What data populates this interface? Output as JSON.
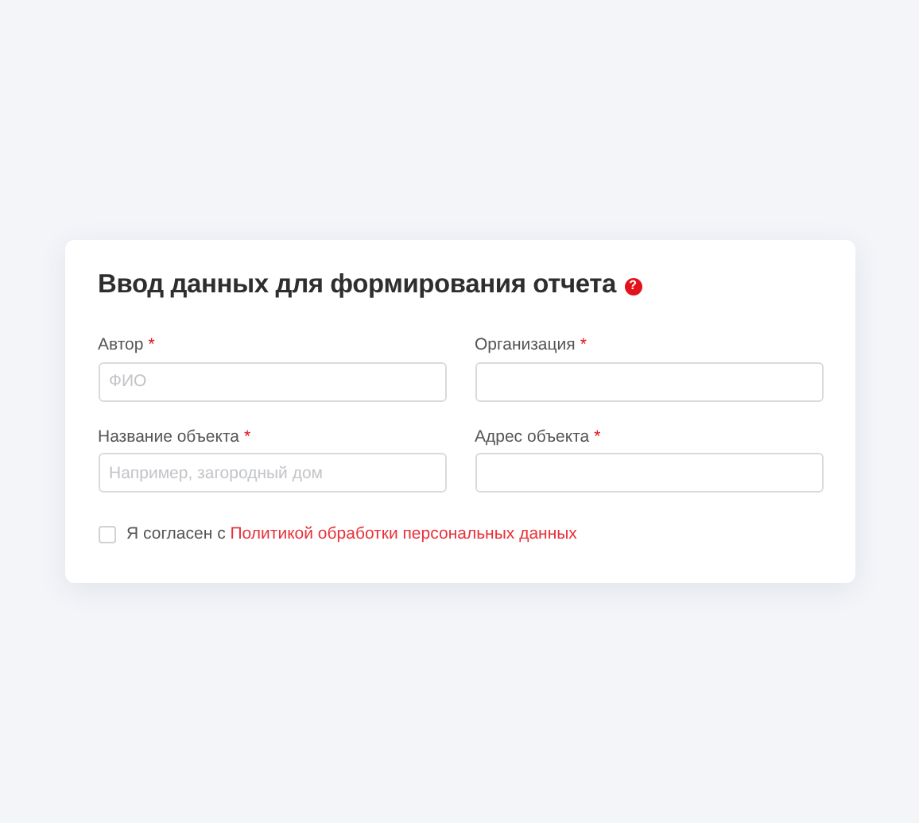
{
  "form": {
    "title": "Ввод данных для формирования отчета",
    "help_icon": "?",
    "fields": [
      {
        "label": "Автор",
        "required_mark": "*",
        "placeholder": "ФИО"
      },
      {
        "label": "Организация",
        "required_mark": "*"
      },
      {
        "label": "Название объекта",
        "required_mark": "*",
        "placeholder": "Например, загородный дом"
      },
      {
        "label": "Адрес объекта",
        "required_mark": "*"
      }
    ],
    "consent": {
      "checked": false,
      "text": "Я согласен с",
      "link": "Политикой обработки персональных данных"
    }
  }
}
